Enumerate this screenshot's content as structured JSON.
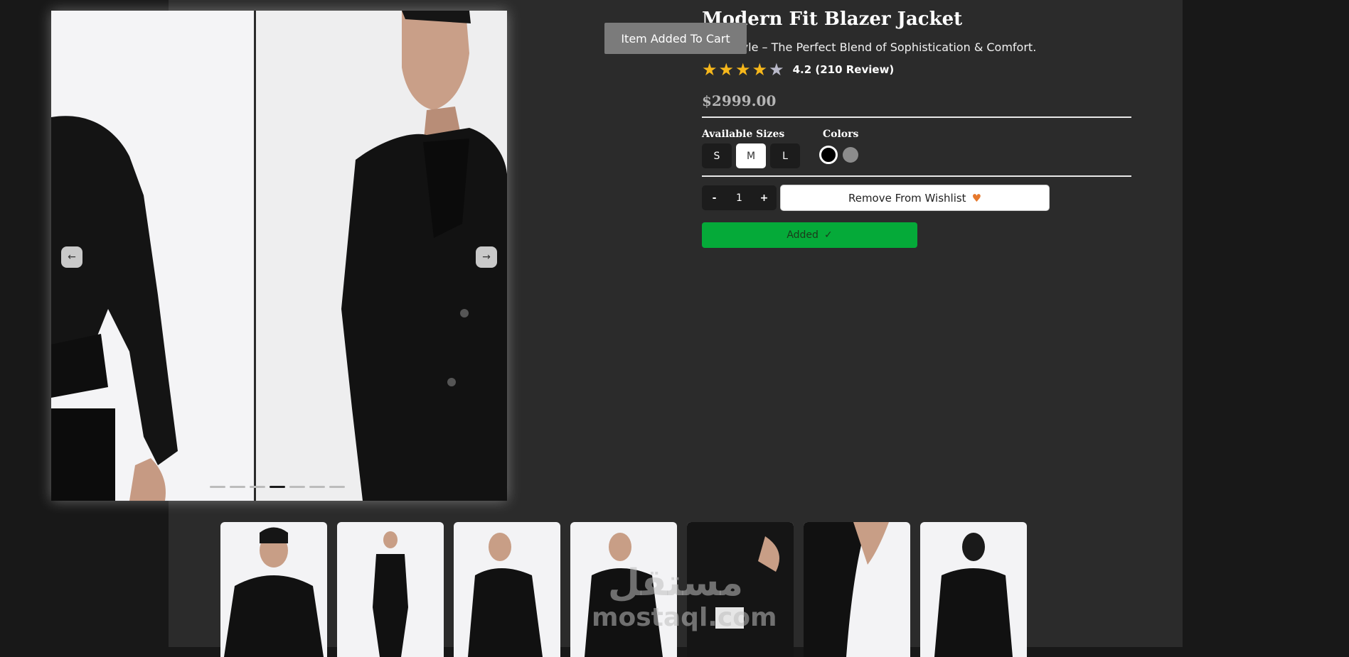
{
  "toast": {
    "text": "Item Added To Cart"
  },
  "product": {
    "title": "Modern Fit Blazer Jacket",
    "subtitle": "Your Style – The Perfect Blend of Sophistication & Comfort.",
    "rating_value": 4.2,
    "rating_stars_filled": 4,
    "rating_stars_total": 5,
    "rating_text": "4.2 (210 Review)",
    "price": "$2999.00"
  },
  "gallery": {
    "prev_icon": "arrow-left-icon",
    "next_icon": "arrow-right-icon",
    "slide_count": 7,
    "active_slide_index": 3
  },
  "options": {
    "sizes_label": "Available Sizes",
    "sizes": [
      "S",
      "M",
      "L"
    ],
    "selected_size": "M",
    "colors_label": "Colors",
    "colors": [
      "#000000",
      "#8c8c8c"
    ],
    "selected_color": "#000000"
  },
  "cart": {
    "decrement_label": "-",
    "quantity": "1",
    "increment_label": "+",
    "wishlist_label": "Remove From Wishlist",
    "wishlist_icon": "heart-icon",
    "added_label": "Added",
    "added_icon": "check-icon"
  },
  "thumbnails": {
    "count": 7
  },
  "watermark": {
    "arabic": "مستقل",
    "latin": "mostaql.com"
  },
  "colors": {
    "page_bg": "#2b2b2b",
    "outer_bg": "#181818",
    "accent_green": "#05aa39",
    "star_yellow": "#f6b71b",
    "heart_orange": "#e6782c"
  }
}
